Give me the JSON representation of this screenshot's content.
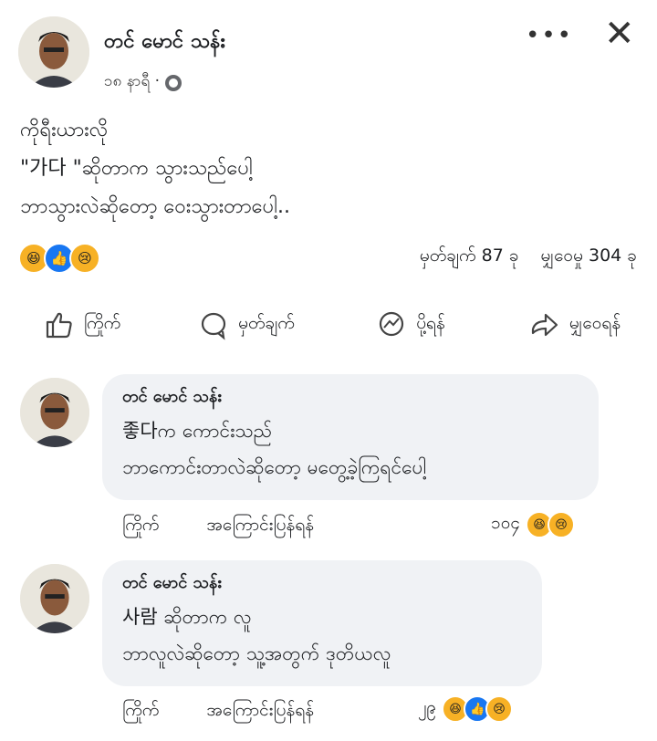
{
  "post": {
    "author": "တင် မောင် သန်း",
    "time": "၁၈ နာရီ ·",
    "lines": [
      "ကိုရီးယားလို",
      "\"가다 \"ဆိုတာက သွားသည်ပေါ့",
      "ဘာသွားလဲဆိုတော့ ဝေးသွားတာပေါ့.."
    ],
    "comment_count": "မှတ်ချက် 87 ခု",
    "share_count": "မျှဝေမှု 304 ခု",
    "reaction_icons": [
      "haha",
      "like",
      "sad"
    ]
  },
  "actions": {
    "like": "ကြိုက်",
    "comment": "မှတ်ချက်",
    "send": "ပို့ရန်",
    "share": "မျှဝေရန်"
  },
  "comments": [
    {
      "author": "တင် မောင် သန်း",
      "lines": [
        "좋다က ကောင်းသည်",
        "ဘာကောင်းတာလဲဆိုတော့ မတွေ့ခဲ့ကြရင်ပေါ့"
      ],
      "like_label": "ကြိုက်",
      "reply_label": "အကြောင်းပြန်ရန်",
      "reaction_count": "၁၀၄",
      "reaction_icons": [
        "haha",
        "sad"
      ]
    },
    {
      "author": "တင် မောင် သန်း",
      "lines": [
        "사람 ဆိုတာက  လူ",
        "ဘာလူလဲဆိုတော့ သူ့အတွက် ဒုတိယလူ"
      ],
      "like_label": "ကြိုက်",
      "reply_label": "အကြောင်းပြန်ရန်",
      "reaction_count": "၂၉",
      "reaction_icons": [
        "haha",
        "like",
        "sad"
      ]
    }
  ],
  "colors": {
    "accent": "#1877f2",
    "bubble": "#f0f2f5",
    "reaction_yellow": "#f7b125"
  }
}
